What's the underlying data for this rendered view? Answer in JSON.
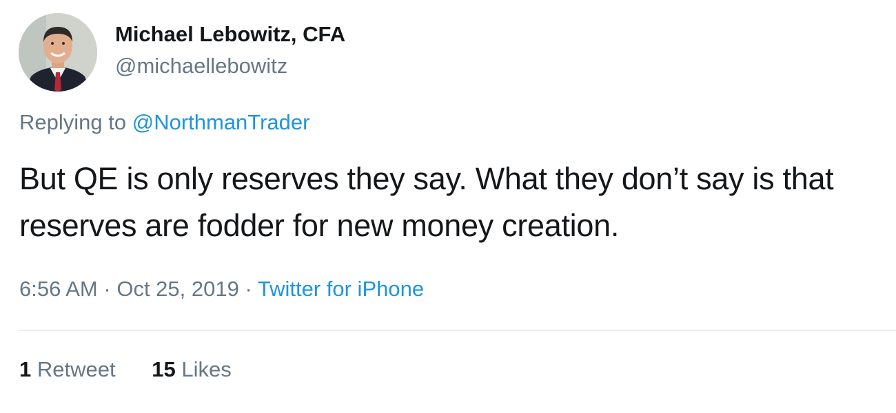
{
  "author": {
    "display_name": "Michael Lebowitz, CFA",
    "handle": "@michaellebowitz"
  },
  "reply": {
    "prefix": "Replying to",
    "mention": "@NorthmanTrader"
  },
  "tweet": {
    "text": "But QE is only reserves they say. What they don’t say is that reserves are fodder for new money creation."
  },
  "meta": {
    "time": "6:56 AM",
    "separator": "·",
    "date": "Oct 25, 2019",
    "source": "Twitter for iPhone"
  },
  "stats": {
    "retweets_count": "1",
    "retweets_label": "Retweet",
    "likes_count": "15",
    "likes_label": "Likes"
  },
  "colors": {
    "link": "#1b95e0",
    "secondary_text": "#657786",
    "primary_text": "#14171a",
    "divider": "#e6ecf0"
  }
}
